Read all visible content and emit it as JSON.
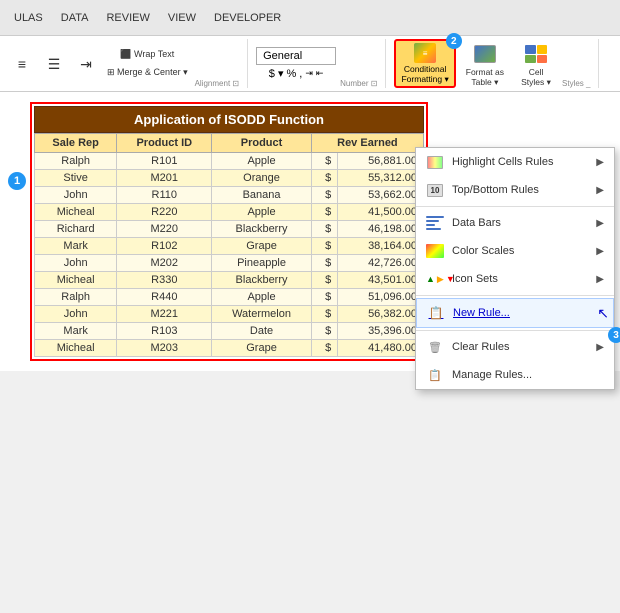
{
  "ribbon": {
    "tabs": [
      "ULAS",
      "DATA",
      "REVIEW",
      "VIEW",
      "DEVELOPER"
    ]
  },
  "toolbar": {
    "number_format": "General",
    "cf_label": "Conditional\nFormatting",
    "format_table_label": "Format as\nTable",
    "cell_styles_label": "Cell\nStyles",
    "styles_section": "Styles _",
    "cf_badge": "2"
  },
  "spreadsheet": {
    "badge1": "1",
    "title": "Application of ISODD Function",
    "headers": [
      "Sale Rep",
      "Product ID",
      "Product",
      "Rev Earned"
    ],
    "rows": [
      [
        "Ralph",
        "R101",
        "Apple",
        "$",
        "56,881.00"
      ],
      [
        "Stive",
        "M201",
        "Orange",
        "$",
        "55,312.00"
      ],
      [
        "John",
        "R110",
        "Banana",
        "$",
        "53,662.00"
      ],
      [
        "Micheal",
        "R220",
        "Apple",
        "$",
        "41,500.00"
      ],
      [
        "Richard",
        "M220",
        "Blackberry",
        "$",
        "46,198.00"
      ],
      [
        "Mark",
        "R102",
        "Grape",
        "$",
        "38,164.00"
      ],
      [
        "John",
        "M202",
        "Pineapple",
        "$",
        "42,726.00"
      ],
      [
        "Micheal",
        "R330",
        "Blackberry",
        "$",
        "43,501.00"
      ],
      [
        "Ralph",
        "R440",
        "Apple",
        "$",
        "51,096.00"
      ],
      [
        "John",
        "M221",
        "Watermelon",
        "$",
        "56,382.00"
      ],
      [
        "Mark",
        "R103",
        "Date",
        "$",
        "35,396.00"
      ],
      [
        "Micheal",
        "M203",
        "Grape",
        "$",
        "41,480.00"
      ]
    ]
  },
  "dropdown": {
    "items": [
      {
        "id": "highlight-cells",
        "label": "Highlight Cells Rules",
        "hasArrow": true,
        "iconType": "highlight"
      },
      {
        "id": "top-bottom",
        "label": "Top/Bottom Rules",
        "hasArrow": true,
        "iconType": "topbottom"
      },
      {
        "id": "data-bars",
        "label": "Data Bars",
        "hasArrow": true,
        "iconType": "databars"
      },
      {
        "id": "color-scales",
        "label": "Color Scales",
        "hasArrow": true,
        "iconType": "colorscale"
      },
      {
        "id": "icon-sets",
        "label": "Icon Sets",
        "hasArrow": true,
        "iconType": "iconsets"
      },
      {
        "id": "new-rule",
        "label": "New Rule...",
        "hasArrow": false,
        "iconType": "newrule"
      },
      {
        "id": "clear-rules",
        "label": "Clear Rules",
        "hasArrow": true,
        "iconType": "clear"
      },
      {
        "id": "manage-rules",
        "label": "Manage Rules...",
        "hasArrow": false,
        "iconType": "manage"
      }
    ],
    "badge3": "3"
  }
}
